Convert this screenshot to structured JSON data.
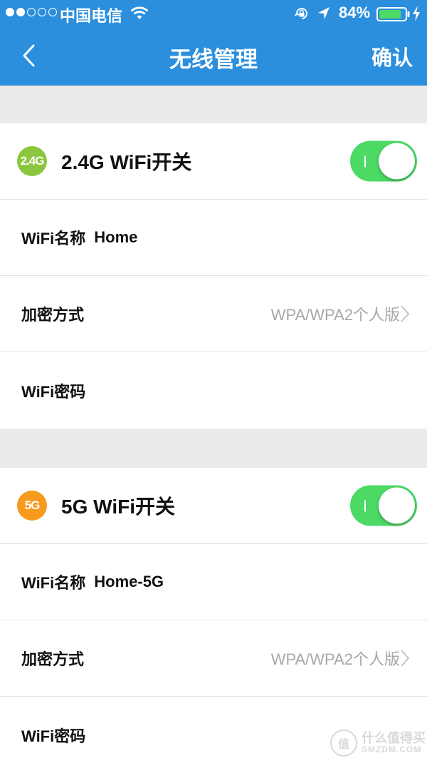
{
  "status_bar": {
    "carrier": "中国电信",
    "battery_pct": "84%"
  },
  "nav": {
    "title": "无线管理",
    "confirm_label": "确认"
  },
  "sections": [
    {
      "badge_text": "2.4G",
      "badge_color": "#8cc63f",
      "toggle_title": "2.4G WiFi开关",
      "enabled": true,
      "name_label": "WiFi名称",
      "name_value": "Home",
      "encryption_label": "加密方式",
      "encryption_value": "WPA/WPA2个人版",
      "password_label": "WiFi密码"
    },
    {
      "badge_text": "5G",
      "badge_color": "#f79a1e",
      "toggle_title": "5G WiFi开关",
      "enabled": true,
      "name_label": "WiFi名称",
      "name_value": "Home-5G",
      "encryption_label": "加密方式",
      "encryption_value": "WPA/WPA2个人版",
      "password_label": "WiFi密码"
    }
  ],
  "colors": {
    "header": "#2b8fde",
    "toggle_on": "#4cd964",
    "page_bg": "#ebebeb"
  },
  "watermark": {
    "logo_text": "值",
    "cn": "什么值得买",
    "en": "SMZDM.COM"
  }
}
